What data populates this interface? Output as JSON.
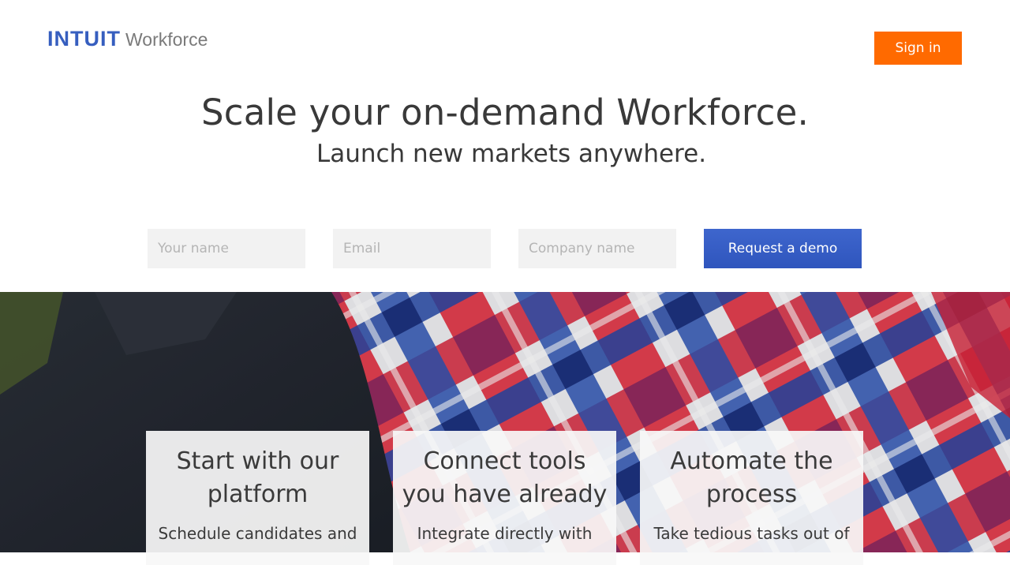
{
  "header": {
    "brand": "INTUIT",
    "product": "Workforce",
    "signin_label": "Sign in"
  },
  "hero": {
    "title": "Scale your on-demand Workforce.",
    "subtitle": "Launch new markets anywhere."
  },
  "form": {
    "name_placeholder": "Your name",
    "email_placeholder": "Email",
    "company_placeholder": "Company name",
    "submit_label": "Request a demo"
  },
  "cards": [
    {
      "title_line1": "Start with our",
      "title_line2": "platform",
      "text": "Schedule candidates and"
    },
    {
      "title_line1": "Connect tools",
      "title_line2": "you have already",
      "text": "Integrate directly with"
    },
    {
      "title_line1": "Automate the",
      "title_line2": "process",
      "text": "Take tedious tasks out of"
    }
  ],
  "colors": {
    "brand_blue": "#365ebf",
    "signin_orange": "#ff6a00",
    "demo_blue": "#3559c4"
  }
}
